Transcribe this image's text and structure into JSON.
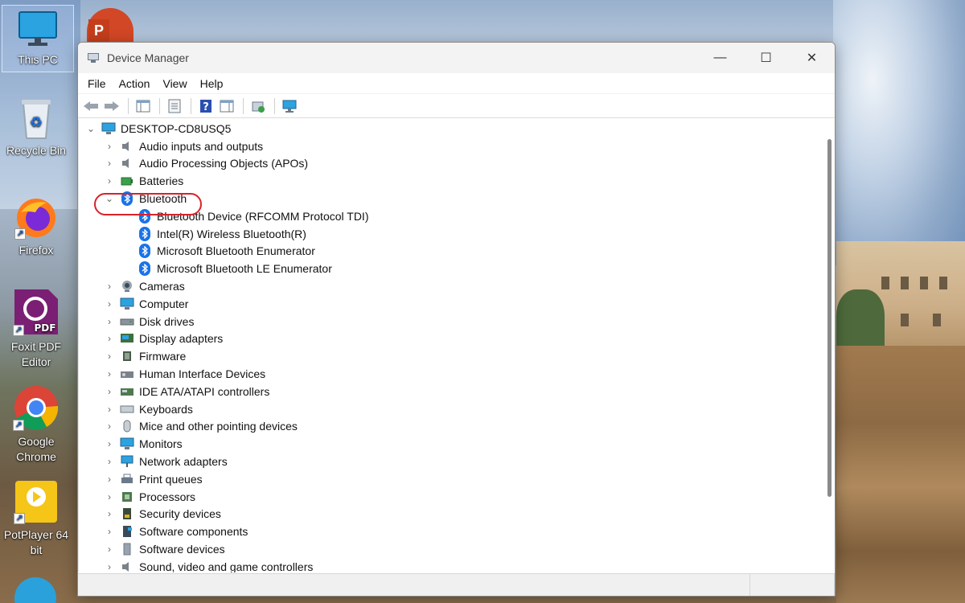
{
  "desktop": {
    "icons": [
      {
        "label": "This PC"
      },
      {
        "label": "Recycle Bin"
      },
      {
        "label": "Firefox"
      },
      {
        "label": "Foxit PDF Editor"
      },
      {
        "label": "Google Chrome"
      },
      {
        "label": "PotPlayer 64 bit"
      }
    ]
  },
  "window": {
    "title": "Device Manager",
    "controls": {
      "minimize": "—",
      "maximize": "☐",
      "close": "✕"
    }
  },
  "menubar": [
    "File",
    "Action",
    "View",
    "Help"
  ],
  "tree": {
    "root": "DESKTOP-CD8USQ5",
    "items": [
      {
        "label": "Audio inputs and outputs",
        "icon": "speaker-icon"
      },
      {
        "label": "Audio Processing Objects (APOs)",
        "icon": "speaker-icon"
      },
      {
        "label": "Batteries",
        "icon": "battery-icon"
      },
      {
        "label": "Bluetooth",
        "icon": "bluetooth-icon",
        "expanded": true,
        "children": [
          "Bluetooth Device (RFCOMM Protocol TDI)",
          "Intel(R) Wireless Bluetooth(R)",
          "Microsoft Bluetooth Enumerator",
          "Microsoft Bluetooth LE Enumerator"
        ]
      },
      {
        "label": "Cameras",
        "icon": "camera-icon"
      },
      {
        "label": "Computer",
        "icon": "monitor-icon"
      },
      {
        "label": "Disk drives",
        "icon": "disk-icon"
      },
      {
        "label": "Display adapters",
        "icon": "display-adapter-icon"
      },
      {
        "label": "Firmware",
        "icon": "chip-icon"
      },
      {
        "label": "Human Interface Devices",
        "icon": "hid-icon"
      },
      {
        "label": "IDE ATA/ATAPI controllers",
        "icon": "ide-icon"
      },
      {
        "label": "Keyboards",
        "icon": "keyboard-icon"
      },
      {
        "label": "Mice and other pointing devices",
        "icon": "mouse-icon"
      },
      {
        "label": "Monitors",
        "icon": "monitor-icon"
      },
      {
        "label": "Network adapters",
        "icon": "network-icon"
      },
      {
        "label": "Print queues",
        "icon": "printer-icon"
      },
      {
        "label": "Processors",
        "icon": "processor-icon"
      },
      {
        "label": "Security devices",
        "icon": "security-icon"
      },
      {
        "label": "Software components",
        "icon": "software-component-icon"
      },
      {
        "label": "Software devices",
        "icon": "software-device-icon"
      },
      {
        "label": "Sound, video and game controllers",
        "icon": "speaker-icon"
      }
    ]
  },
  "colors": {
    "accent": "#1a73e8",
    "highlight": "#d9222a"
  }
}
